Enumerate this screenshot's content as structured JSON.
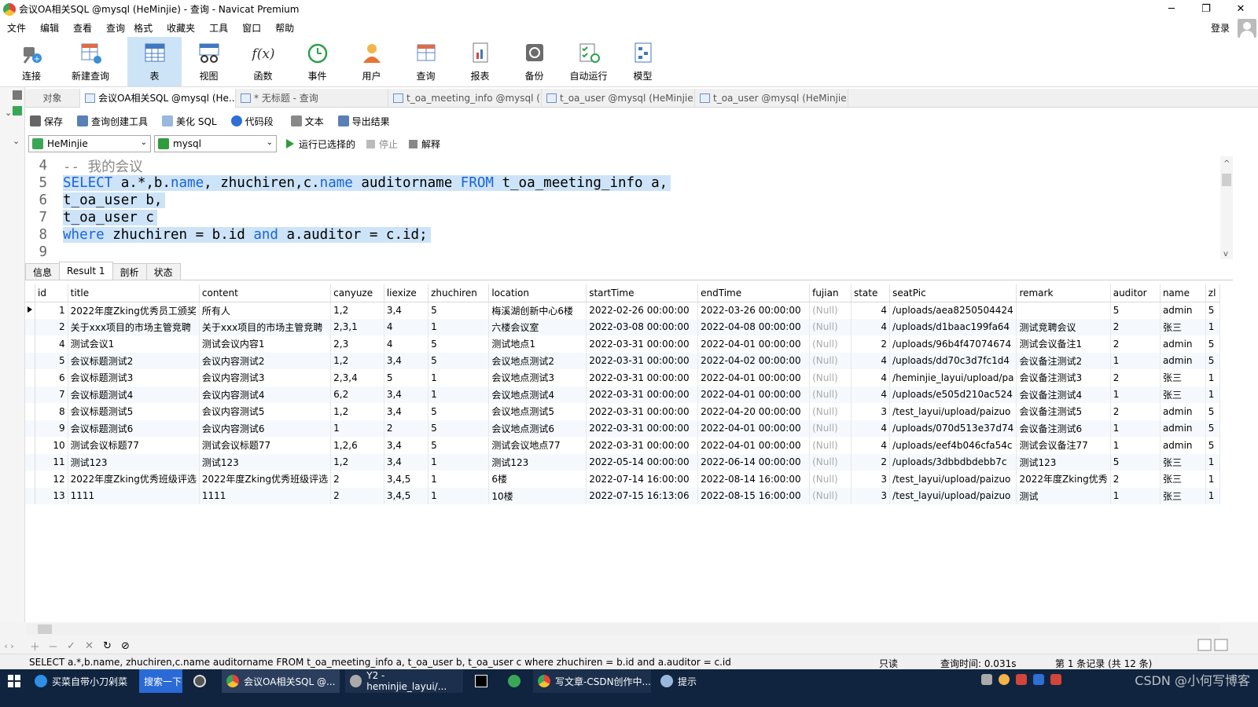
{
  "window": {
    "title": "会议OA相关SQL @mysql (HeMinjie) - 查询 - Navicat Premium",
    "minimize": "─",
    "maximize": "❐",
    "close": "✕"
  },
  "menu": [
    "文件",
    "编辑",
    "查看",
    "查询",
    "格式",
    "收藏夹",
    "工具",
    "窗口",
    "帮助"
  ],
  "login_label": "登录",
  "toolbar": [
    {
      "label": "连接",
      "icon": "plug-icon"
    },
    {
      "label": "新建查询",
      "icon": "new-query-icon"
    },
    {
      "label": "表",
      "icon": "table-icon",
      "active": true
    },
    {
      "label": "视图",
      "icon": "view-icon"
    },
    {
      "label": "函数",
      "icon": "function-icon",
      "glyph": "f(x)"
    },
    {
      "label": "事件",
      "icon": "clock-icon"
    },
    {
      "label": "用户",
      "icon": "user-icon"
    },
    {
      "label": "查询",
      "icon": "query-icon"
    },
    {
      "label": "报表",
      "icon": "report-icon"
    },
    {
      "label": "备份",
      "icon": "backup-icon"
    },
    {
      "label": "自动运行",
      "icon": "autorun-icon"
    },
    {
      "label": "模型",
      "icon": "model-icon"
    }
  ],
  "doc_tabs": [
    {
      "label": "对象"
    },
    {
      "label": "会议OA相关SQL @mysql (He..."
    },
    {
      "label": "* 无标题 - 查询"
    },
    {
      "label": "t_oa_meeting_info @mysql (..."
    },
    {
      "label": "t_oa_user @mysql (HeMinjie..."
    },
    {
      "label": "t_oa_user @mysql (HeMinjie..."
    }
  ],
  "query_toolbar": [
    "保存",
    "查询创建工具",
    "美化 SQL",
    "代码段",
    "文本",
    "导出结果"
  ],
  "connection": "HeMinjie",
  "database": "mysql",
  "run_selected": "运行已选择的",
  "stop": "停止",
  "explain": "解释",
  "editor": {
    "lines": [
      {
        "no": "4",
        "tokens": [
          {
            "t": "-- 我的会议",
            "c": "cm"
          }
        ],
        "hl": false
      },
      {
        "no": "5",
        "tokens": [
          {
            "t": "SELECT",
            "c": "kw"
          },
          {
            "t": " a.*,b.",
            "c": ""
          },
          {
            "t": "name",
            "c": "kw"
          },
          {
            "t": ", zhuchiren,c.",
            "c": ""
          },
          {
            "t": "name",
            "c": "kw"
          },
          {
            "t": " auditorname ",
            "c": ""
          },
          {
            "t": "FROM",
            "c": "kw"
          },
          {
            "t": " t_oa_meeting_info a,",
            "c": ""
          }
        ],
        "hl": true
      },
      {
        "no": "6",
        "tokens": [
          {
            "t": "t_oa_user b,",
            "c": ""
          }
        ],
        "hl": true
      },
      {
        "no": "7",
        "tokens": [
          {
            "t": "t_oa_user c",
            "c": ""
          }
        ],
        "hl": true
      },
      {
        "no": "8",
        "tokens": [
          {
            "t": "where",
            "c": "kw"
          },
          {
            "t": " zhuchiren = b.id ",
            "c": ""
          },
          {
            "t": "and",
            "c": "kw"
          },
          {
            "t": " a.auditor = c.id;",
            "c": ""
          }
        ],
        "hl": true
      },
      {
        "no": "9",
        "tokens": [],
        "hl": false
      }
    ]
  },
  "result_tabs": [
    "信息",
    "Result 1",
    "剖析",
    "状态"
  ],
  "table": {
    "columns": [
      "id",
      "title",
      "content",
      "canyuze",
      "liexize",
      "zhuchiren",
      "location",
      "startTime",
      "endTime",
      "fujian",
      "state",
      "seatPic",
      "remark",
      "auditor",
      "name",
      "zl"
    ],
    "rows": [
      [
        "1",
        "2022年度Zking优秀员工颁奖",
        "所有人",
        "1,2",
        "3,4",
        "5",
        "梅溪湖创新中心6楼",
        "2022-02-26 00:00:00",
        "2022-03-26 00:00:00",
        "(Null)",
        "4",
        "/uploads/aea8250504424",
        "",
        "5",
        "admin",
        "5"
      ],
      [
        "2",
        "关于xxx项目的市场主管竞聘",
        "关于xxx项目的市场主管竞聘",
        "2,3,1",
        "4",
        "1",
        "六楼会议室",
        "2022-03-08 00:00:00",
        "2022-04-08 00:00:00",
        "(Null)",
        "4",
        "/uploads/d1baac199fa64",
        "测试竞聘会议",
        "2",
        "张三",
        "1"
      ],
      [
        "4",
        "测试会议1",
        "测试会议内容1",
        "2,3",
        "4",
        "5",
        "测试地点1",
        "2022-03-31 00:00:00",
        "2022-04-01 00:00:00",
        "(Null)",
        "2",
        "/uploads/96b4f47074674",
        "测试会议备注1",
        "2",
        "admin",
        "5"
      ],
      [
        "5",
        "会议标题测试2",
        "会议内容测试2",
        "1,2",
        "3,4",
        "5",
        "会议地点测试2",
        "2022-03-31 00:00:00",
        "2022-04-02 00:00:00",
        "(Null)",
        "4",
        "/uploads/dd70c3d7fc1d4",
        "会议备注测试2",
        "1",
        "admin",
        "5"
      ],
      [
        "6",
        "会议标题测试3",
        "会议内容测试3",
        "2,3,4",
        "5",
        "1",
        "会议地点测试3",
        "2022-03-31 00:00:00",
        "2022-04-01 00:00:00",
        "(Null)",
        "4",
        "/heminjie_layui/upload/pa",
        "会议备注测试3",
        "2",
        "张三",
        "1"
      ],
      [
        "7",
        "会议标题测试4",
        "会议内容测试4",
        "6,2",
        "3,4",
        "1",
        "会议地点测试4",
        "2022-03-31 00:00:00",
        "2022-04-01 00:00:00",
        "(Null)",
        "4",
        "/uploads/e505d210ac524",
        "会议备注测试4",
        "1",
        "张三",
        "1"
      ],
      [
        "8",
        "会议标题测试5",
        "会议内容测试5",
        "1,2",
        "3,4",
        "5",
        "会议地点测试5",
        "2022-03-31 00:00:00",
        "2022-04-20 00:00:00",
        "(Null)",
        "3",
        "/test_layui/upload/paizuo",
        "会议备注测试5",
        "2",
        "admin",
        "5"
      ],
      [
        "9",
        " 会议标题测试6",
        " 会议内容测试6",
        "1",
        "2",
        "5",
        " 会议地点测试6",
        "2022-03-31 00:00:00",
        "2022-04-01 00:00:00",
        "(Null)",
        "4",
        "/uploads/070d513e37d74",
        " 会议备注测试6",
        "1",
        "admin",
        "5"
      ],
      [
        "10",
        "测试会议标题77",
        "测试会议标题77",
        "1,2,6",
        "3,4",
        "5",
        "测试会议地点77",
        "2022-03-31 00:00:00",
        "2022-04-01 00:00:00",
        "(Null)",
        "4",
        "/uploads/eef4b046cfa54c",
        "测试会议备注77",
        "1",
        "admin",
        "5"
      ],
      [
        "11",
        "测试123",
        "测试123",
        "1,2",
        "3,4",
        "1",
        "测试123",
        "2022-05-14 00:00:00",
        "2022-06-14 00:00:00",
        "(Null)",
        "2",
        "/uploads/3dbbdbdebb7c",
        "测试123",
        "5",
        "张三",
        "1"
      ],
      [
        "12",
        "2022年度Zking优秀班级评选",
        "2022年度Zking优秀班级评选",
        "2",
        "3,4,5",
        "1",
        "6楼",
        "2022-07-14 16:00:00",
        "2022-08-14 16:00:00",
        "(Null)",
        "3",
        "/test_layui/upload/paizuo",
        "2022年度Zking优秀",
        "2",
        "张三",
        "1"
      ],
      [
        "13",
        "1111",
        "1111",
        "2",
        "3,4,5",
        "1",
        "10楼",
        "2022-07-15 16:13:06",
        "2022-08-15 16:00:00",
        "(Null)",
        "3",
        "/test_layui/upload/paizuo",
        "测试",
        "1",
        "张三",
        "1"
      ]
    ]
  },
  "nav_buttons": [
    "＋",
    "－",
    "✓",
    "✕",
    "↻",
    "⊘"
  ],
  "status": {
    "sql": "SELECT a.*,b.name, zhuchiren,c.name auditorname FROM t_oa_meeting_info a, t_oa_user b, t_oa_user c where zhuchiren = b.id and a.auditor = c.id",
    "readonly": "只读",
    "query_time": "查询时间: 0.031s",
    "record": "第 1 条记录 (共 12 条)"
  },
  "taskbar": {
    "items": [
      "买菜自带小刀剁菜",
      "搜索一下",
      "会议OA相关SQL @...",
      "Y2 - heminjie_layui/...",
      "写文章-CSDN创作中...",
      "提示"
    ],
    "watermark": "CSDN @小何写博客"
  },
  "colors": {
    "accent": "#cde4f7",
    "selection": "#cde3f7",
    "keyword": "#1a64d8",
    "taskbar": "#10243f"
  }
}
